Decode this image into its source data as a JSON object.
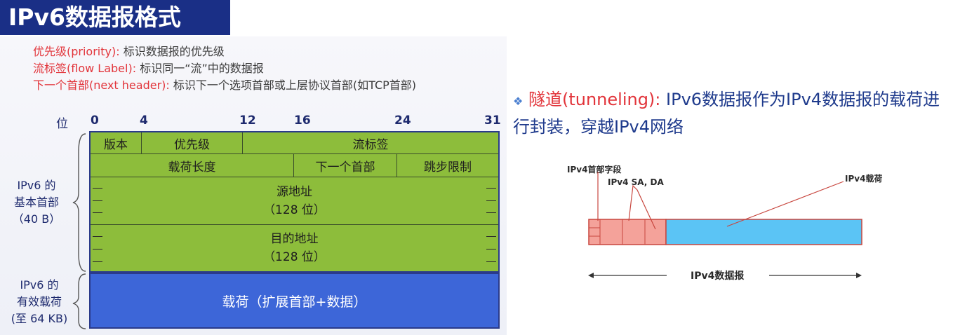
{
  "title": "IPv6数据报格式",
  "definitions": [
    {
      "term": "优先级(priority):",
      "desc": "标识数据报的优先级"
    },
    {
      "term": "流标签(flow Label):",
      "desc": "标识同一“流”中的数据报"
    },
    {
      "term": "下一个首部(next header):",
      "desc": "标识下一个选项首部或上层协议首部(如TCP首部)"
    }
  ],
  "bit_axis": {
    "label": "位",
    "ticks": [
      "0",
      "4",
      "12",
      "16",
      "24",
      "31"
    ]
  },
  "header_fields": {
    "version": "版本",
    "priority": "优先级",
    "flow_label": "流标签",
    "payload_length": "载荷长度",
    "next_header": "下一个首部",
    "hop_limit": "跳步限制",
    "src_addr": "源地址",
    "src_size": "（128 位）",
    "dst_addr": "目的地址",
    "dst_size": "（128 位）"
  },
  "payload_label": "载荷（扩展首部+数据）",
  "side_labels": {
    "header": [
      "IPv6 的",
      "基本首部",
      "（40 B）"
    ],
    "payload": [
      "IPv6 的",
      "有效载荷",
      "(至 64 KB)"
    ]
  },
  "tunneling": {
    "term": "隧道(tunneling):",
    "desc": "IPv6数据报作为IPv4数据报的载荷进行封装，穿越IPv4网络"
  },
  "tunnel_diagram": {
    "ipv4_header_label": "IPv4首部字段",
    "sa_da_label": "IPv4 SA, DA",
    "payload_label": "IPv4载荷",
    "datagram_label": "IPv4数据报"
  },
  "colors": {
    "title_bg": "#1a2f86",
    "header_green": "#8dbd3b",
    "payload_blue": "#3d66d8",
    "accent_red": "#e2343a",
    "ipv4_header_pink": "#f4a29a",
    "ipv4_payload_cyan": "#5bc4f5"
  }
}
